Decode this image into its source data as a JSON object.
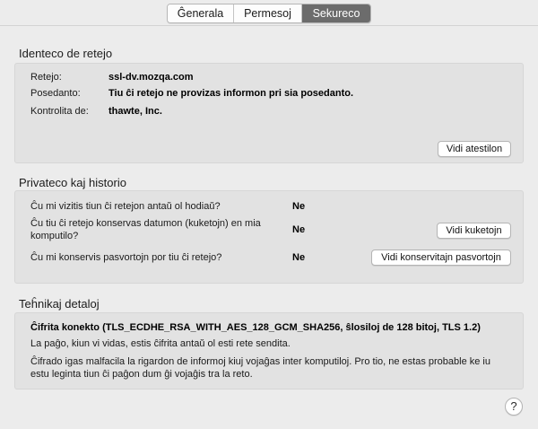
{
  "tabs": [
    {
      "label": "Ĝenerala",
      "active": false
    },
    {
      "label": "Permesoj",
      "active": false
    },
    {
      "label": "Sekureco",
      "active": true
    }
  ],
  "identity": {
    "title": "Identeco de retejo",
    "website_label": "Retejo:",
    "website_value": "ssl-dv.mozqa.com",
    "owner_label": "Posedanto:",
    "owner_value": "Tiu ĉi retejo ne provizas informon pri sia posedanto.",
    "verifier_label": "Kontrolita de:",
    "verifier_value": "thawte, Inc.",
    "view_cert_button": "Vidi atestilon"
  },
  "privacy": {
    "title": "Privateco kaj historio",
    "q1": "Ĉu mi vizitis tiun ĉi retejon antaŭ ol hodiaŭ?",
    "a1": "Ne",
    "q2": "Ĉu tiu ĉi retejo konservas datumon (kuketojn) en mia komputilo?",
    "a2": "Ne",
    "view_cookies_button": "Vidi kuketojn",
    "q3": "Ĉu mi konservis pasvortojn por tiu ĉi retejo?",
    "a3": "Ne",
    "view_passwords_button": "Vidi konservitajn pasvortojn"
  },
  "technical": {
    "title": "Teĥnikaj detaloj",
    "cipher": "Ĉifrita konekto (TLS_ECDHE_RSA_WITH_AES_128_GCM_SHA256, ŝlosiloj de 128 bitoj, TLS 1.2)",
    "line1": "La paĝo, kiun vi vidas, estis ĉifrita antaŭ ol esti rete sendita.",
    "line2": "Ĉifrado igas malfacila la rigardon de informoj kiuj vojaĝas inter komputiloj. Pro tio, ne estas probable ke iu estu leginta tiun ĉi paĝon dum ĝi vojaĝis tra la reto."
  },
  "help": {
    "label": "?",
    "icon": "help-icon"
  }
}
